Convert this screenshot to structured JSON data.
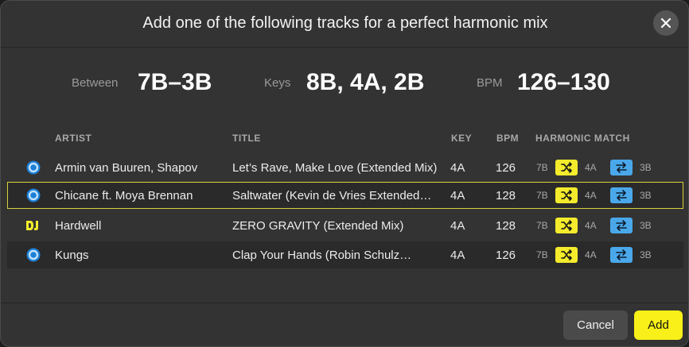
{
  "dialog": {
    "title": "Add one of the following tracks for a perfect harmonic mix"
  },
  "summary": {
    "between_label": "Between",
    "between_value": "7B–3B",
    "keys_label": "Keys",
    "keys_value": "8B, 4A, 2B",
    "bpm_label": "BPM",
    "bpm_value": "126–130"
  },
  "columns": {
    "artist": "ARTIST",
    "title": "TITLE",
    "key": "KEY",
    "bpm": "BPM",
    "harmonic_match": "HARMONIC MATCH"
  },
  "tracks": [
    {
      "source": "beatport",
      "artist": "Armin van Buuren, Shapov",
      "title": "Let’s Rave, Make Love (Extended Mix)",
      "key": "4A",
      "bpm": "126",
      "match": {
        "from": "7B",
        "mid": "4A",
        "to": "3B"
      }
    },
    {
      "source": "beatport",
      "artist": "Chicane ft. Moya Brennan",
      "title": "Saltwater (Kevin de Vries Extended…",
      "key": "4A",
      "bpm": "128",
      "match": {
        "from": "7B",
        "mid": "4A",
        "to": "3B"
      }
    },
    {
      "source": "dj",
      "artist": "Hardwell",
      "title": "ZERO GRAVITY (Extended Mix)",
      "key": "4A",
      "bpm": "128",
      "match": {
        "from": "7B",
        "mid": "4A",
        "to": "3B"
      }
    },
    {
      "source": "beatport",
      "artist": "Kungs",
      "title": "Clap Your Hands (Robin Schulz…",
      "key": "4A",
      "bpm": "126",
      "match": {
        "from": "7B",
        "mid": "4A",
        "to": "3B"
      }
    }
  ],
  "footer": {
    "cancel_label": "Cancel",
    "add_label": "Add"
  },
  "colors": {
    "accent_yellow": "#f8f018",
    "shuffle_yellow": "#f3eb2c",
    "swap_blue": "#4aa8ea",
    "selection_outline": "#d8d23a"
  },
  "icons": {
    "close": "close-icon",
    "source_beatport": "beatport-icon",
    "source_dj": "dj-logo-icon",
    "shuffle": "shuffle-icon",
    "swap": "swap-arrows-icon"
  }
}
